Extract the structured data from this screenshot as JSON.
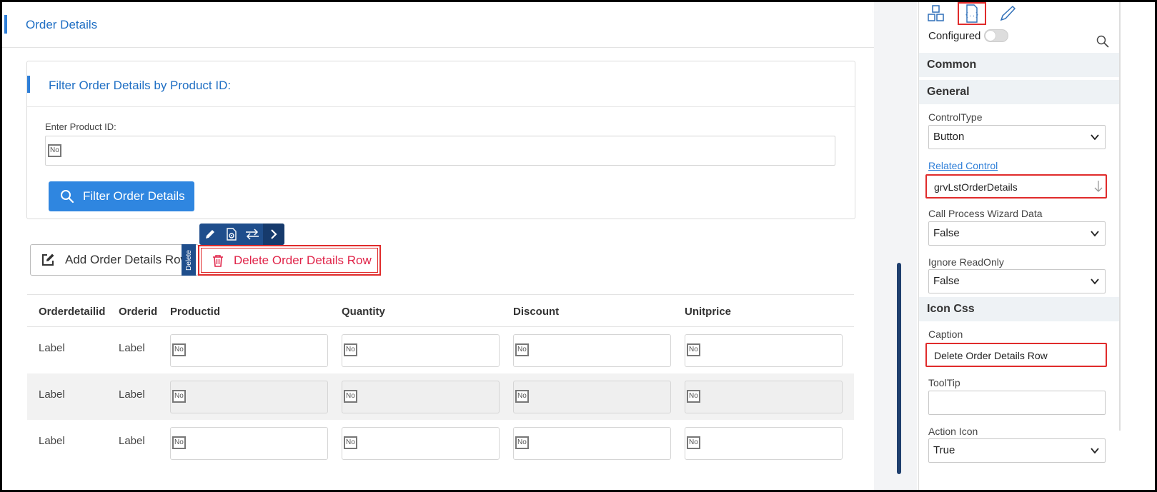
{
  "page": {
    "title": "Order Details"
  },
  "filter": {
    "title": "Filter Order Details by Product ID:",
    "field_label": "Enter Product ID:",
    "field_chip": "No",
    "button_label": "Filter Order Details",
    "button_icon": "search-icon"
  },
  "toolbar": {
    "icons": [
      "pencil-icon",
      "document-settings-icon",
      "swap-arrows-icon",
      "chevron-right-icon"
    ]
  },
  "actions": {
    "add_label": "Add Order Details Row",
    "add_icon": "edit-square-icon",
    "delete_tag": "Delete",
    "delete_label": "Delete Order Details Row",
    "delete_icon": "trash-icon"
  },
  "grid": {
    "columns": [
      "Orderdetailid",
      "Orderid",
      "Productid",
      "Quantity",
      "Discount",
      "Unitprice"
    ],
    "rows": [
      {
        "orderdetailid": "Label",
        "orderid": "Label",
        "chips": [
          "No",
          "No",
          "No",
          "No"
        ]
      },
      {
        "orderdetailid": "Label",
        "orderid": "Label",
        "chips": [
          "No",
          "No",
          "No",
          "No"
        ]
      },
      {
        "orderdetailid": "Label",
        "orderid": "Label",
        "chips": [
          "No",
          "No",
          "No",
          "No"
        ]
      }
    ]
  },
  "panel": {
    "tabs": [
      "layout-icon",
      "code-braces-icon",
      "brush-icon"
    ],
    "configured_label": "Configured",
    "configured_on": false,
    "sections": {
      "common": "Common",
      "general": "General",
      "icon_css": "Icon Css"
    },
    "control_type": {
      "label": "ControlType",
      "value": "Button"
    },
    "related_control": {
      "label": "Related Control",
      "value": "grvLstOrderDetails"
    },
    "call_process": {
      "label": "Call Process Wizard Data",
      "value": "False"
    },
    "ignore_readonly": {
      "label": "Ignore ReadOnly",
      "value": "False"
    },
    "caption": {
      "label": "Caption",
      "value": "Delete Order Details Row"
    },
    "tooltip": {
      "label": "ToolTip",
      "value": ""
    },
    "action_icon": {
      "label": "Action Icon",
      "value": "True"
    }
  },
  "colors": {
    "accent": "#2f7fd8",
    "danger": "#e02b2b",
    "toolbar": "#1f4e8c"
  }
}
